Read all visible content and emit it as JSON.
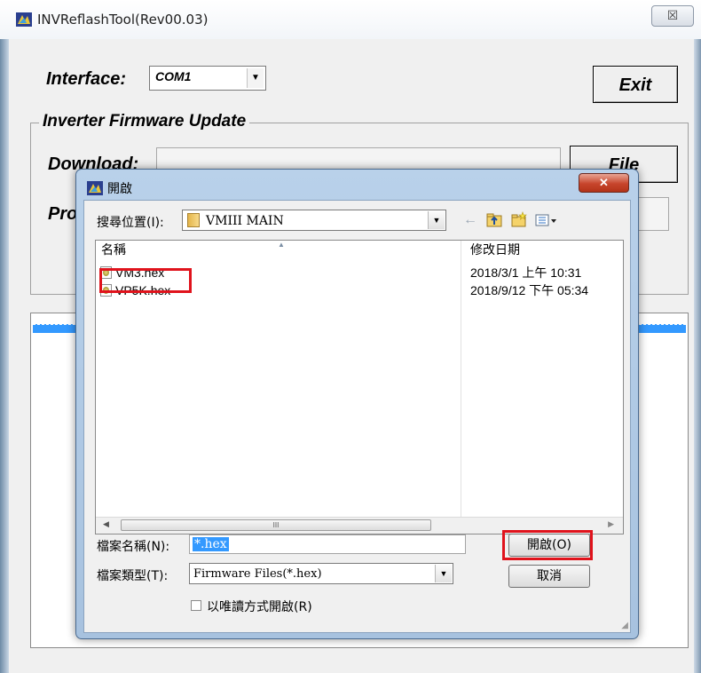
{
  "main_window": {
    "title": "INVReflashTool(Rev00.03)",
    "close_glyph": "☒",
    "interface_label": "Interface:",
    "interface_value": "COM1",
    "exit_label": "Exit",
    "group_title": "Inverter Firmware Update",
    "download_label": "Download:",
    "progress_label_visible": "Pro",
    "file_label": "File"
  },
  "dialog": {
    "title": "開啟",
    "close_glyph": "✕",
    "look_in_label": "搜尋位置(I):",
    "look_in_value": "VMIII MAIN",
    "toolbar_icons": [
      "back-icon",
      "up-folder-icon",
      "new-folder-icon",
      "view-menu-icon"
    ],
    "columns": {
      "name": "名稱",
      "date_modified": "修改日期"
    },
    "files": [
      {
        "name": "VM3.hex",
        "date": "2018/3/1 上午 10:31"
      },
      {
        "name": "VP5K.hex",
        "date": "2018/9/12 下午 05:34"
      }
    ],
    "scroll_thumb_text": "III",
    "file_name_label": "檔案名稱(N):",
    "file_name_value": "*.hex",
    "file_type_label": "檔案類型(T):",
    "file_type_value": "Firmware Files(*.hex)",
    "readonly_label": "以唯讀方式開啟(R)",
    "open_button": "開啟(O)",
    "cancel_button": "取消"
  },
  "colors": {
    "highlight_red": "#e0131c",
    "selection_blue": "#3399ff"
  }
}
